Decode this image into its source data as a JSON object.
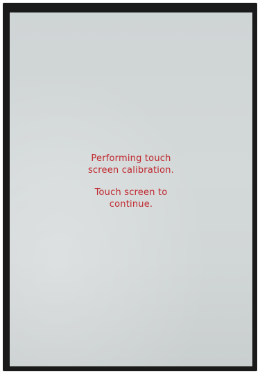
{
  "screen": {
    "background_color": "#d2d7d7",
    "text_color": "#c0282f",
    "calibration_message": {
      "line1": "Performing touch",
      "line2": "screen calibration.",
      "line3": "Touch screen to",
      "line4": "continue."
    }
  }
}
